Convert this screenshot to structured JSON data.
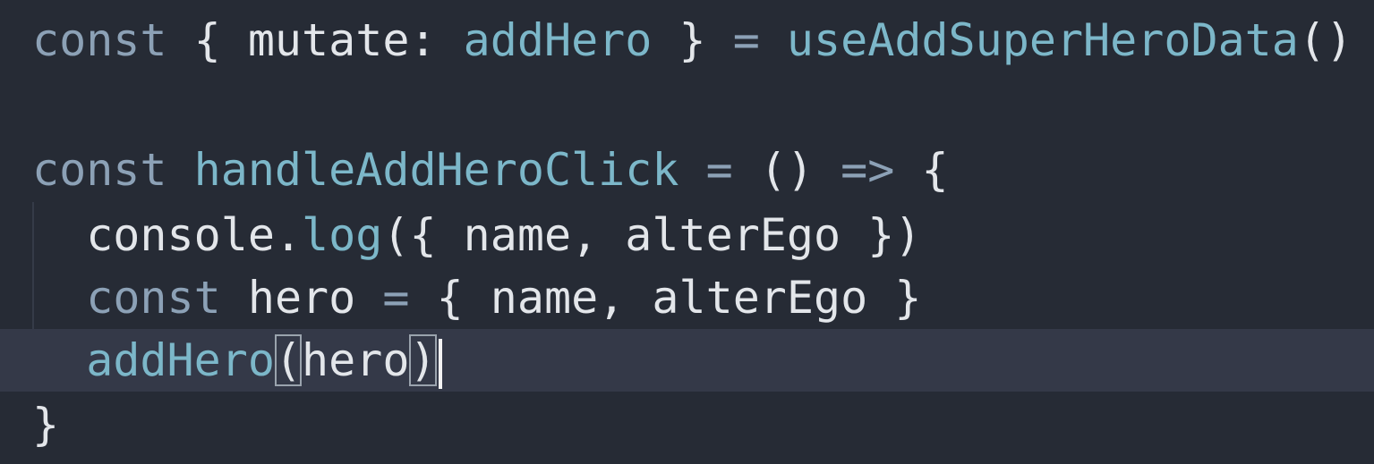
{
  "editor": {
    "lines": [
      {
        "id": "line-1",
        "tokens": [
          {
            "t": "const",
            "c": "kw"
          },
          {
            "t": " { ",
            "c": "pl"
          },
          {
            "t": "mutate",
            "c": "pl"
          },
          {
            "t": ": ",
            "c": "pl"
          },
          {
            "t": "addHero",
            "c": "fn"
          },
          {
            "t": " } ",
            "c": "pl"
          },
          {
            "t": "=",
            "c": "op"
          },
          {
            "t": " ",
            "c": "pl"
          },
          {
            "t": "useAddSuperHeroData",
            "c": "fn"
          },
          {
            "t": "()",
            "c": "pl"
          }
        ]
      },
      {
        "id": "line-2",
        "tokens": []
      },
      {
        "id": "line-3",
        "tokens": [
          {
            "t": "const",
            "c": "kw"
          },
          {
            "t": " ",
            "c": "pl"
          },
          {
            "t": "handleAddHeroClick",
            "c": "fn"
          },
          {
            "t": " ",
            "c": "pl"
          },
          {
            "t": "=",
            "c": "op"
          },
          {
            "t": " () ",
            "c": "pl"
          },
          {
            "t": "=>",
            "c": "op"
          },
          {
            "t": " {",
            "c": "pl"
          }
        ]
      },
      {
        "id": "line-4",
        "tokens": [
          {
            "t": "  console",
            "c": "pl"
          },
          {
            "t": ".",
            "c": "pl"
          },
          {
            "t": "log",
            "c": "fn"
          },
          {
            "t": "({ name, alterEgo })",
            "c": "pl"
          }
        ]
      },
      {
        "id": "line-5",
        "tokens": [
          {
            "t": "  ",
            "c": "pl"
          },
          {
            "t": "const",
            "c": "kw"
          },
          {
            "t": " hero ",
            "c": "pl"
          },
          {
            "t": "=",
            "c": "op"
          },
          {
            "t": " { name, alterEgo }",
            "c": "pl"
          }
        ]
      },
      {
        "id": "line-6",
        "current": true,
        "tokens": [
          {
            "t": "  ",
            "c": "pl"
          },
          {
            "t": "addHero",
            "c": "fn"
          },
          {
            "t": "(",
            "c": "pl",
            "match": true
          },
          {
            "t": "hero",
            "c": "pl"
          },
          {
            "t": ")",
            "c": "pl",
            "match": true
          }
        ],
        "cursor": true
      },
      {
        "id": "line-7",
        "tokens": [
          {
            "t": "}",
            "c": "pl"
          }
        ]
      }
    ]
  },
  "colors": {
    "background": "#262b35",
    "current_line": "#343948",
    "keyword": "#8ca1b6",
    "function": "#7cb7c9",
    "plain": "#e3e6ea"
  }
}
